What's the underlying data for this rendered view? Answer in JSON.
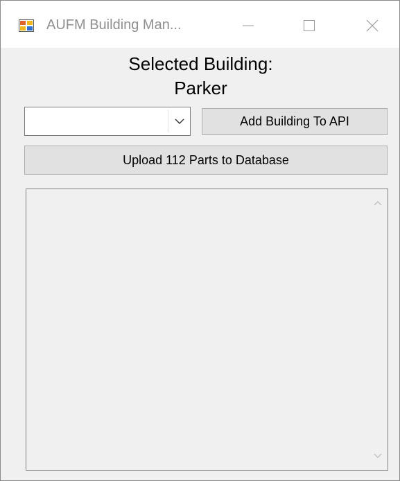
{
  "window": {
    "title": "AUFM Building Man...",
    "minimize_icon": "minimize-icon",
    "maximize_icon": "maximize-icon",
    "close_icon": "close-icon"
  },
  "header": {
    "selected_label": "Selected Building:",
    "selected_building": "Parker"
  },
  "building_combo": {
    "value": "",
    "arrow_icon": "chevron-down-icon"
  },
  "buttons": {
    "add_building": "Add Building To API",
    "upload_parts": "Upload 112 Parts to Database"
  },
  "output_list": {
    "items": [],
    "scroll_up_icon": "chevron-up-icon",
    "scroll_down_icon": "chevron-down-icon"
  },
  "colors": {
    "window_bg": "#f0f0f0",
    "titlebar_bg": "#ffffff",
    "button_bg": "#e1e1e1",
    "button_border": "#adadad",
    "title_text": "#8f8f8f"
  }
}
